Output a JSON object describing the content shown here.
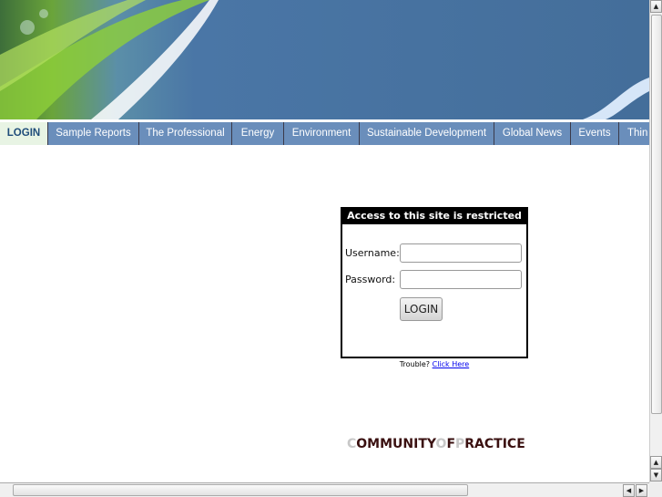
{
  "nav": {
    "tabs": [
      {
        "label": "LOGIN",
        "active": true
      },
      {
        "label": "Sample Reports"
      },
      {
        "label": "The Professional"
      },
      {
        "label": "Energy"
      },
      {
        "label": "Environment"
      },
      {
        "label": "Sustainable Development"
      },
      {
        "label": "Global News"
      },
      {
        "label": "Events"
      },
      {
        "label": "Thin"
      }
    ]
  },
  "login": {
    "title": "Access to this site is restricted",
    "username_label": "Username:",
    "username_value": "",
    "password_label": "Password:",
    "password_value": "",
    "button": "LOGIN",
    "trouble_text": "Trouble?",
    "trouble_link": "Click Here"
  },
  "footer_logo": {
    "c": "C",
    "ommunity": "OMMUNITY",
    "o": "O",
    "f": "F",
    "p": "P",
    "ractice": "RACTICE"
  },
  "colors": {
    "header": "#446e9a",
    "nav": "#6a8ebb",
    "active_tab": "#e8f4e4"
  }
}
